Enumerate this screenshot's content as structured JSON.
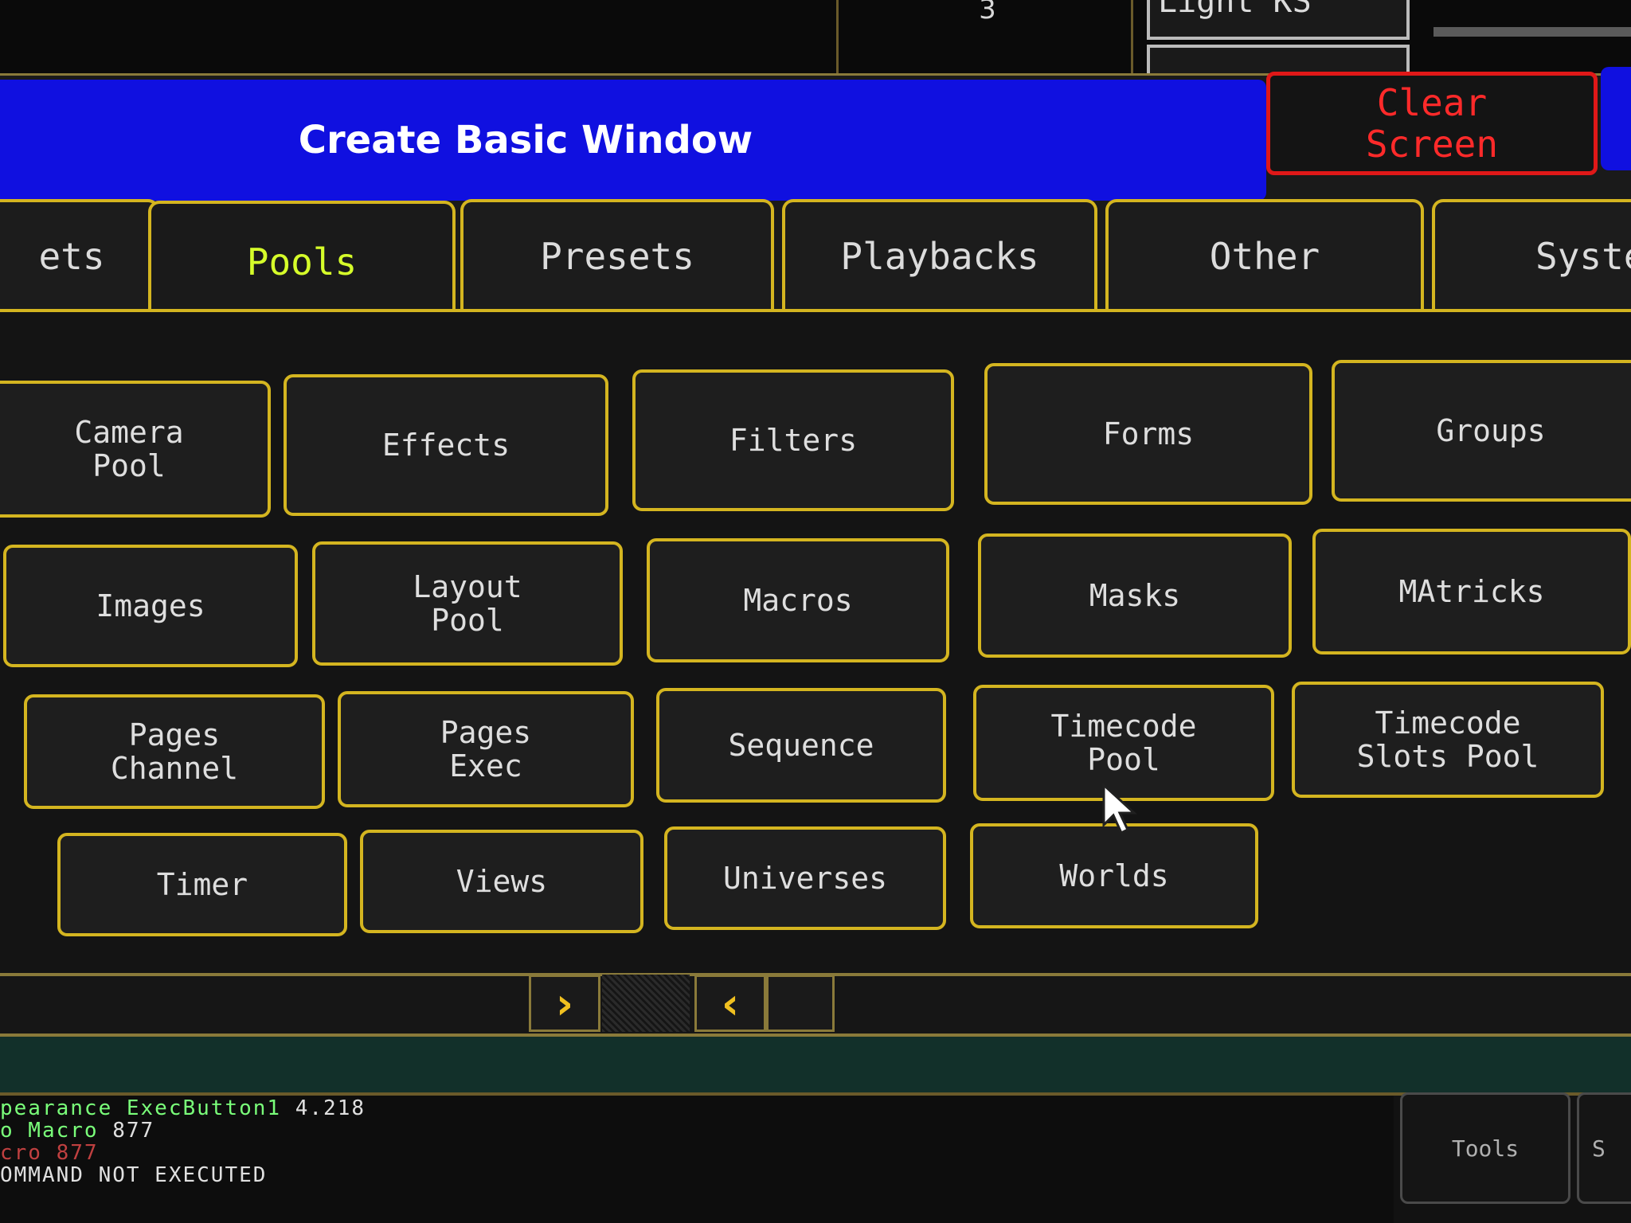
{
  "background": {
    "cell_number": "3",
    "cell_label": "Light KS"
  },
  "dialog": {
    "title": "Create Basic Window",
    "clear_button": "Clear\nScreen"
  },
  "tabs": [
    {
      "label": "ets",
      "active": false
    },
    {
      "label": "Pools",
      "active": true
    },
    {
      "label": "Presets",
      "active": false
    },
    {
      "label": "Playbacks",
      "active": false
    },
    {
      "label": "Other",
      "active": false
    },
    {
      "label": "Syste",
      "active": false
    }
  ],
  "pools": [
    "Camera\nPool",
    "Effects",
    "Filters",
    "Forms",
    "Groups",
    "Images",
    "Layout\nPool",
    "Macros",
    "Masks",
    "MAtricks",
    "Pages\nChannel",
    "Pages\nExec",
    "Sequence",
    "Timecode\nPool",
    "Timecode\nSlots Pool",
    "Timer",
    "Views",
    "Universes",
    "Worlds"
  ],
  "nav": {
    "next": "›",
    "prev": "‹"
  },
  "command_line": [
    {
      "text": "pearance ExecButton1",
      "value": " 4.218",
      "color": "#7aff7a"
    },
    {
      "text": "o Macro",
      "value": " 877",
      "color": "#7aff7a"
    },
    {
      "text": "cro 877",
      "value": "",
      "color": "#c04040"
    },
    {
      "text": "OMMAND NOT EXECUTED",
      "value": "",
      "color": "#e0e0e0"
    }
  ],
  "tools": {
    "label": "Tools",
    "label2": "S"
  },
  "colors": {
    "title_bar": "#1010e0",
    "accent_border": "#d4b520",
    "clear_red": "#e01818",
    "active_tab": "#d6ff2a"
  }
}
